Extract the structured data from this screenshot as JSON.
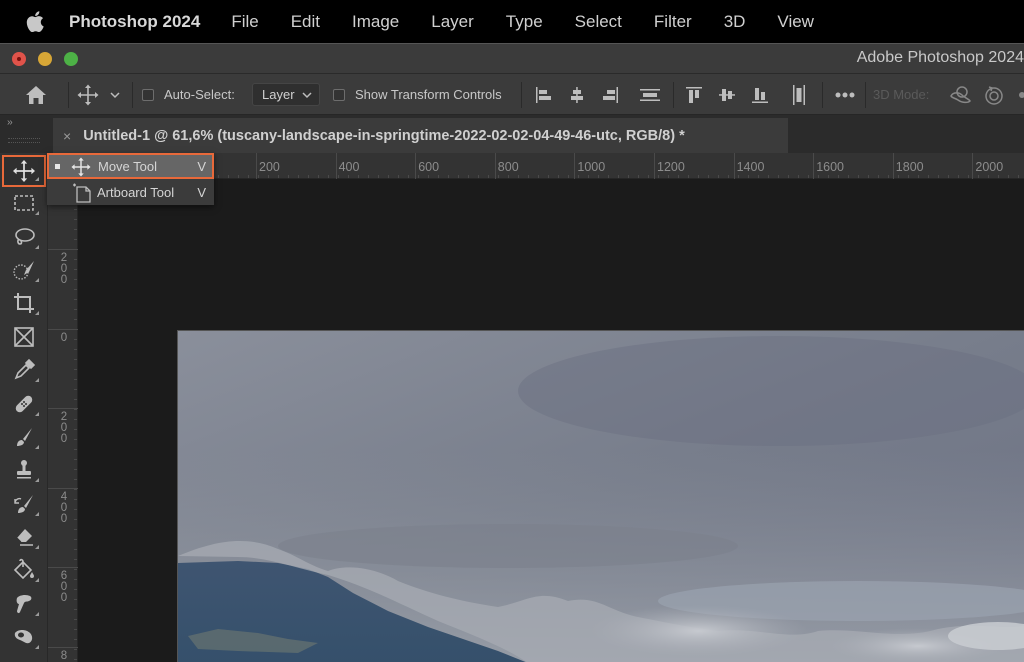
{
  "menubar": {
    "apple_icon": "apple-logo-icon",
    "app_name": "Photoshop 2024",
    "items": [
      "File",
      "Edit",
      "Image",
      "Layer",
      "Type",
      "Select",
      "Filter",
      "3D",
      "View"
    ]
  },
  "window": {
    "title": "Adobe Photoshop 2024",
    "traffic_lights": [
      "close",
      "minimize",
      "maximize"
    ]
  },
  "options_bar": {
    "home_icon": "home-icon",
    "tool_icon": "move-icon",
    "auto_select_label": "Auto-Select:",
    "auto_select_checked": false,
    "auto_select_value": "Layer",
    "show_transform_label": "Show Transform Controls",
    "show_transform_checked": false,
    "align_icons": [
      "align-left-edges-icon",
      "align-horizontal-centers-icon",
      "align-right-edges-icon",
      "distribute-horizontally-icon",
      "align-top-edges-icon",
      "align-vertical-centers-icon",
      "align-bottom-edges-icon",
      "distribute-vertically-icon"
    ],
    "more_icon": "more-options-icon",
    "mode_3d_label": "3D Mode:",
    "mode_3d_icons": [
      "orbit-3d-icon",
      "roll-3d-icon"
    ]
  },
  "panel": {
    "collapse_label": "››"
  },
  "document": {
    "tab_title": "Untitled-1 @ 61,6% (tuscany-landscape-in-springtime-2022-02-02-04-49-46-utc, RGB/8) *",
    "close_label": "×"
  },
  "rulers": {
    "horizontal": [
      "200",
      "400",
      "600",
      "800",
      "1000",
      "1200",
      "1400",
      "1600",
      "1800",
      "2000"
    ],
    "vertical": [
      "200",
      "0",
      "200",
      "400",
      "600",
      "8"
    ]
  },
  "tools": [
    {
      "name": "move-tool",
      "icon": "move-icon",
      "active": true
    },
    {
      "name": "rectangular-marquee-tool",
      "icon": "marquee-icon"
    },
    {
      "name": "lasso-tool",
      "icon": "lasso-icon"
    },
    {
      "name": "quick-selection-tool",
      "icon": "quick-selection-icon"
    },
    {
      "name": "crop-tool",
      "icon": "crop-icon"
    },
    {
      "name": "frame-tool",
      "icon": "frame-icon"
    },
    {
      "name": "eyedropper-tool",
      "icon": "eyedropper-icon"
    },
    {
      "name": "spot-healing-tool",
      "icon": "bandage-icon"
    },
    {
      "name": "brush-tool",
      "icon": "brush-icon"
    },
    {
      "name": "clone-stamp-tool",
      "icon": "stamp-icon"
    },
    {
      "name": "history-brush-tool",
      "icon": "history-brush-icon"
    },
    {
      "name": "eraser-tool",
      "icon": "eraser-icon"
    },
    {
      "name": "paint-bucket-tool",
      "icon": "paint-bucket-icon"
    },
    {
      "name": "smudge-tool",
      "icon": "smudge-icon"
    },
    {
      "name": "dodge-tool",
      "icon": "dodge-icon"
    }
  ],
  "flyout": {
    "items": [
      {
        "label": "Move Tool",
        "shortcut": "V",
        "icon": "move-icon",
        "selected": true
      },
      {
        "label": "Artboard Tool",
        "shortcut": "V",
        "icon": "artboard-icon",
        "selected": false
      }
    ]
  },
  "colors": {
    "accent": "#e8693a",
    "app_bg": "#3b3b3b",
    "pasteboard": "#1b1b1b"
  }
}
